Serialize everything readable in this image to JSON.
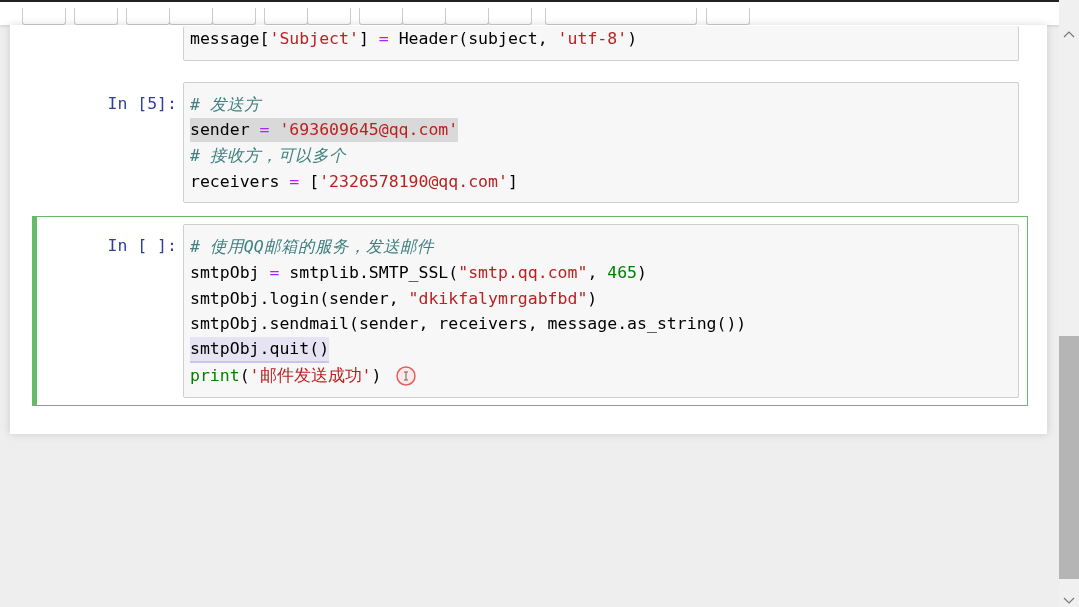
{
  "toolbar": {
    "groups": [
      [
        {
          "kind": "button"
        }
      ],
      [
        {
          "kind": "button"
        }
      ],
      [
        {
          "kind": "button"
        },
        {
          "kind": "button"
        },
        {
          "kind": "button"
        }
      ],
      [
        {
          "kind": "button"
        },
        {
          "kind": "button"
        }
      ],
      [
        {
          "kind": "button"
        },
        {
          "kind": "button"
        },
        {
          "kind": "button"
        },
        {
          "kind": "button"
        }
      ],
      [
        {
          "kind": "select"
        }
      ],
      [
        {
          "kind": "button"
        }
      ]
    ]
  },
  "cells": [
    {
      "selected": false,
      "cut_top": true,
      "lines": [
        {
          "selected": false,
          "matched": false,
          "tokens": [
            {
              "kind": "name",
              "text": "message["
            },
            {
              "kind": "string",
              "text": "'Subject'"
            },
            {
              "kind": "name",
              "text": "] "
            },
            {
              "kind": "op",
              "text": "="
            },
            {
              "kind": "name",
              "text": " Header(subject, "
            },
            {
              "kind": "string",
              "text": "'utf-8'"
            },
            {
              "kind": "name",
              "text": ")"
            }
          ]
        }
      ]
    },
    {
      "prompt": "In [5]:",
      "selected": false,
      "cut_top": false,
      "lines": [
        {
          "selected": false,
          "matched": false,
          "tokens": [
            {
              "kind": "comment",
              "text": "# 发送方"
            }
          ]
        },
        {
          "selected": true,
          "matched": false,
          "tokens": [
            {
              "kind": "name",
              "text": "sender "
            },
            {
              "kind": "op",
              "text": "="
            },
            {
              "kind": "string",
              "text": " '693609645@qq.com'"
            }
          ]
        },
        {
          "selected": false,
          "matched": false,
          "tokens": [
            {
              "kind": "comment",
              "text": "# 接收方，可以多个"
            }
          ]
        },
        {
          "selected": false,
          "matched": false,
          "tokens": [
            {
              "kind": "name",
              "text": "receivers "
            },
            {
              "kind": "op",
              "text": "="
            },
            {
              "kind": "name",
              "text": " ["
            },
            {
              "kind": "string",
              "text": "'2326578190@qq.com'"
            },
            {
              "kind": "name",
              "text": "]"
            }
          ]
        }
      ]
    },
    {
      "prompt": "In [ ]:",
      "selected": true,
      "cut_top": false,
      "lines": [
        {
          "selected": false,
          "matched": false,
          "tokens": [
            {
              "kind": "comment",
              "text": "# 使用QQ邮箱的服务，发送邮件"
            }
          ]
        },
        {
          "selected": false,
          "matched": false,
          "tokens": [
            {
              "kind": "name",
              "text": "smtpObj "
            },
            {
              "kind": "op",
              "text": "="
            },
            {
              "kind": "name",
              "text": " smtplib.SMTP_SSL("
            },
            {
              "kind": "string",
              "text": "\"smtp.qq.com\""
            },
            {
              "kind": "name",
              "text": ", "
            },
            {
              "kind": "number",
              "text": "465"
            },
            {
              "kind": "name",
              "text": ")"
            }
          ]
        },
        {
          "selected": false,
          "matched": false,
          "tokens": [
            {
              "kind": "name",
              "text": "smtpObj.login(sender, "
            },
            {
              "kind": "string",
              "text": "\"dkikfalymrgabfbd\""
            },
            {
              "kind": "name",
              "text": ")"
            }
          ]
        },
        {
          "selected": false,
          "matched": false,
          "tokens": [
            {
              "kind": "name",
              "text": "smtpObj.sendmail(sender, receivers, message.as_string())"
            }
          ]
        },
        {
          "selected": false,
          "matched": true,
          "tokens": [
            {
              "kind": "name",
              "text": "smtpObj.quit()"
            }
          ]
        },
        {
          "selected": false,
          "matched": false,
          "cursor": true,
          "tokens": [
            {
              "kind": "builtin",
              "text": "print"
            },
            {
              "kind": "name",
              "text": "("
            },
            {
              "kind": "string",
              "text": "'邮件发送成功'"
            },
            {
              "kind": "name",
              "text": ")"
            }
          ]
        }
      ]
    }
  ]
}
